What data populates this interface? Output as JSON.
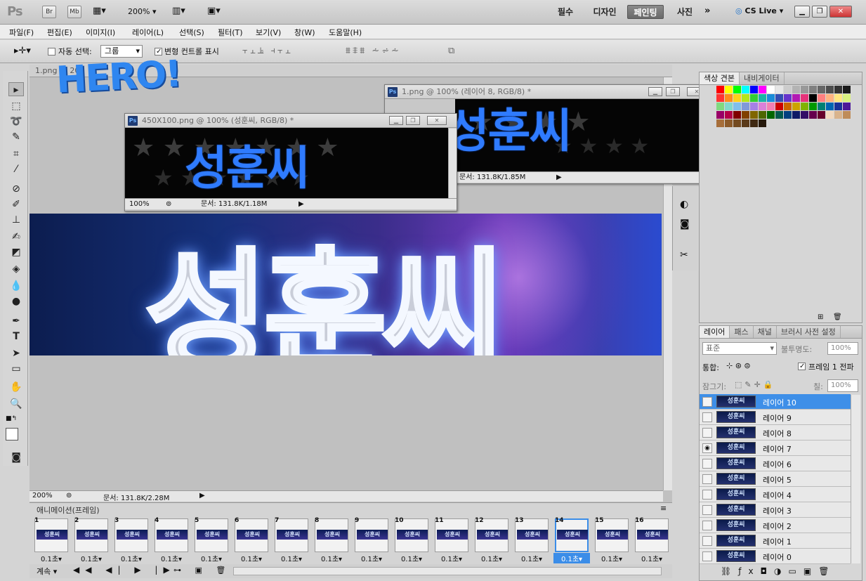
{
  "app": {
    "logo": "Ps",
    "br_label": "Br",
    "mb_label": "Mb",
    "zoom": "200%"
  },
  "workspaces": [
    {
      "label": "필수"
    },
    {
      "label": "디자인"
    },
    {
      "label": "페인팅"
    },
    {
      "label": "사진"
    }
  ],
  "cslive": "CS Live",
  "menu": [
    "파일(F)",
    "편집(E)",
    "이미지(I)",
    "레이어(L)",
    "선택(S)",
    "필터(T)",
    "보기(V)",
    "창(W)",
    "도움말(H)"
  ],
  "options": {
    "auto_select": "자동 선택:",
    "auto_select_value": "그룹",
    "transform_controls": "변형 컨트롤 표시"
  },
  "docs": {
    "back_tab": "1.png @ 20",
    "win1": {
      "title": "1.png @ 100% (레이어 8, RGB/8) *",
      "status": "문서: 131.8K/1.85M"
    },
    "win2": {
      "title": "450X100.png @ 100% (성훈씨, RGB/8) *",
      "zoom": "100%",
      "status": "문서: 131.8K/1.18M"
    },
    "main": {
      "zoom": "200%",
      "status": "문서: 131.8K/2.28M"
    },
    "banner_text": "성훈씨"
  },
  "hero_text": "HERO!",
  "swatches_panel": {
    "tabs": [
      "색상 견본",
      "내비게이터"
    ]
  },
  "layers_panel": {
    "tabs": [
      "레이어",
      "패스",
      "채널",
      "브러시 사전 설정"
    ],
    "blend": "표준",
    "opacity_label": "불투명도:",
    "opacity": "100%",
    "unify_label": "통합:",
    "propagate": "프레임 1 전파",
    "lock_label": "잠그기:",
    "fill_label": "칠:",
    "fill": "100%",
    "layers": [
      {
        "name": "레이어 10",
        "selected": true,
        "visible": false
      },
      {
        "name": "레이어 9",
        "selected": false,
        "visible": false
      },
      {
        "name": "레이어 8",
        "selected": false,
        "visible": false
      },
      {
        "name": "레이어 7",
        "selected": false,
        "visible": true
      },
      {
        "name": "레이어 6",
        "selected": false,
        "visible": false
      },
      {
        "name": "레이어 5",
        "selected": false,
        "visible": false
      },
      {
        "name": "레이어 4",
        "selected": false,
        "visible": false
      },
      {
        "name": "레이어 3",
        "selected": false,
        "visible": false
      },
      {
        "name": "레이어 2",
        "selected": false,
        "visible": false
      },
      {
        "name": "레이어 1",
        "selected": false,
        "visible": false
      },
      {
        "name": "레이어 0",
        "selected": false,
        "visible": false
      }
    ],
    "thumb_text": "성훈씨"
  },
  "animation": {
    "title": "애니메이션(프레임)",
    "loop": "계속",
    "frames": [
      {
        "num": "1",
        "delay": "0.1초"
      },
      {
        "num": "2",
        "delay": "0.1초"
      },
      {
        "num": "3",
        "delay": "0.1초"
      },
      {
        "num": "4",
        "delay": "0.1초"
      },
      {
        "num": "5",
        "delay": "0.1초"
      },
      {
        "num": "6",
        "delay": "0.1초"
      },
      {
        "num": "7",
        "delay": "0.1초"
      },
      {
        "num": "8",
        "delay": "0.1초"
      },
      {
        "num": "9",
        "delay": "0.1초"
      },
      {
        "num": "10",
        "delay": "0.1초"
      },
      {
        "num": "11",
        "delay": "0.1초"
      },
      {
        "num": "12",
        "delay": "0.1초"
      },
      {
        "num": "13",
        "delay": "0.1초"
      },
      {
        "num": "14",
        "delay": "0.1초"
      },
      {
        "num": "15",
        "delay": "0.1초"
      },
      {
        "num": "16",
        "delay": "0.1초"
      }
    ],
    "selected_frame": "14"
  }
}
